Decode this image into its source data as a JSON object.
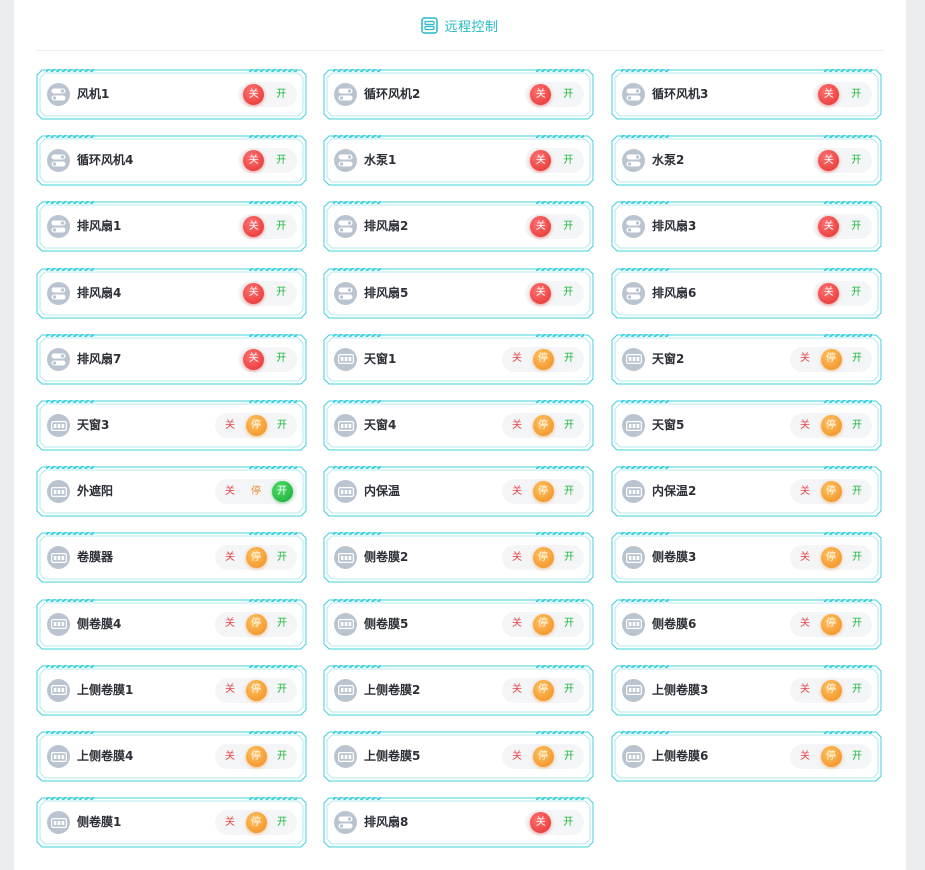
{
  "header": {
    "title": "远程控制",
    "icon": "control-panel-icon"
  },
  "colors": {
    "accent": "#25b9c7",
    "frame": "#3fd0dc",
    "off": "#e84545",
    "stop": "#f08b1d",
    "on": "#1db83c",
    "icon_bg": "#bac4d0"
  },
  "devices": [
    {
      "name": "风机1",
      "kind": "fan",
      "options": [
        "关",
        "开"
      ],
      "active": "关"
    },
    {
      "name": "循环风机2",
      "kind": "fan",
      "options": [
        "关",
        "开"
      ],
      "active": "关"
    },
    {
      "name": "循环风机3",
      "kind": "fan",
      "options": [
        "关",
        "开"
      ],
      "active": "关"
    },
    {
      "name": "循环风机4",
      "kind": "fan",
      "options": [
        "关",
        "开"
      ],
      "active": "关"
    },
    {
      "name": "水泵1",
      "kind": "fan",
      "options": [
        "关",
        "开"
      ],
      "active": "关"
    },
    {
      "name": "水泵2",
      "kind": "fan",
      "options": [
        "关",
        "开"
      ],
      "active": "关"
    },
    {
      "name": "排风扇1",
      "kind": "fan",
      "options": [
        "关",
        "开"
      ],
      "active": "关"
    },
    {
      "name": "排风扇2",
      "kind": "fan",
      "options": [
        "关",
        "开"
      ],
      "active": "关"
    },
    {
      "name": "排风扇3",
      "kind": "fan",
      "options": [
        "关",
        "开"
      ],
      "active": "关"
    },
    {
      "name": "排风扇4",
      "kind": "fan",
      "options": [
        "关",
        "开"
      ],
      "active": "关"
    },
    {
      "name": "排风扇5",
      "kind": "fan",
      "options": [
        "关",
        "开"
      ],
      "active": "关"
    },
    {
      "name": "排风扇6",
      "kind": "fan",
      "options": [
        "关",
        "开"
      ],
      "active": "关"
    },
    {
      "name": "排风扇7",
      "kind": "fan",
      "options": [
        "关",
        "开"
      ],
      "active": "关"
    },
    {
      "name": "天窗1",
      "kind": "window",
      "options": [
        "关",
        "停",
        "开"
      ],
      "active": "停"
    },
    {
      "name": "天窗2",
      "kind": "window",
      "options": [
        "关",
        "停",
        "开"
      ],
      "active": "停"
    },
    {
      "name": "天窗3",
      "kind": "window",
      "options": [
        "关",
        "停",
        "开"
      ],
      "active": "停"
    },
    {
      "name": "天窗4",
      "kind": "window",
      "options": [
        "关",
        "停",
        "开"
      ],
      "active": "停"
    },
    {
      "name": "天窗5",
      "kind": "window",
      "options": [
        "关",
        "停",
        "开"
      ],
      "active": "停"
    },
    {
      "name": "外遮阳",
      "kind": "window",
      "options": [
        "关",
        "停",
        "开"
      ],
      "active": "开"
    },
    {
      "name": "内保温",
      "kind": "window",
      "options": [
        "关",
        "停",
        "开"
      ],
      "active": "停"
    },
    {
      "name": "内保温2",
      "kind": "window",
      "options": [
        "关",
        "停",
        "开"
      ],
      "active": "停"
    },
    {
      "name": "卷膜器",
      "kind": "window",
      "options": [
        "关",
        "停",
        "开"
      ],
      "active": "停"
    },
    {
      "name": "侧卷膜2",
      "kind": "window",
      "options": [
        "关",
        "停",
        "开"
      ],
      "active": "停"
    },
    {
      "name": "侧卷膜3",
      "kind": "window",
      "options": [
        "关",
        "停",
        "开"
      ],
      "active": "停"
    },
    {
      "name": "侧卷膜4",
      "kind": "window",
      "options": [
        "关",
        "停",
        "开"
      ],
      "active": "停"
    },
    {
      "name": "侧卷膜5",
      "kind": "window",
      "options": [
        "关",
        "停",
        "开"
      ],
      "active": "停"
    },
    {
      "name": "侧卷膜6",
      "kind": "window",
      "options": [
        "关",
        "停",
        "开"
      ],
      "active": "停"
    },
    {
      "name": "上侧卷膜1",
      "kind": "window",
      "options": [
        "关",
        "停",
        "开"
      ],
      "active": "停"
    },
    {
      "name": "上侧卷膜2",
      "kind": "window",
      "options": [
        "关",
        "停",
        "开"
      ],
      "active": "停"
    },
    {
      "name": "上侧卷膜3",
      "kind": "window",
      "options": [
        "关",
        "停",
        "开"
      ],
      "active": "停"
    },
    {
      "name": "上侧卷膜4",
      "kind": "window",
      "options": [
        "关",
        "停",
        "开"
      ],
      "active": "停"
    },
    {
      "name": "上侧卷膜5",
      "kind": "window",
      "options": [
        "关",
        "停",
        "开"
      ],
      "active": "停"
    },
    {
      "name": "上侧卷膜6",
      "kind": "window",
      "options": [
        "关",
        "停",
        "开"
      ],
      "active": "停"
    },
    {
      "name": "侧卷膜1",
      "kind": "window",
      "options": [
        "关",
        "停",
        "开"
      ],
      "active": "停"
    },
    {
      "name": "排风扇8",
      "kind": "fan",
      "options": [
        "关",
        "开"
      ],
      "active": "关"
    }
  ]
}
